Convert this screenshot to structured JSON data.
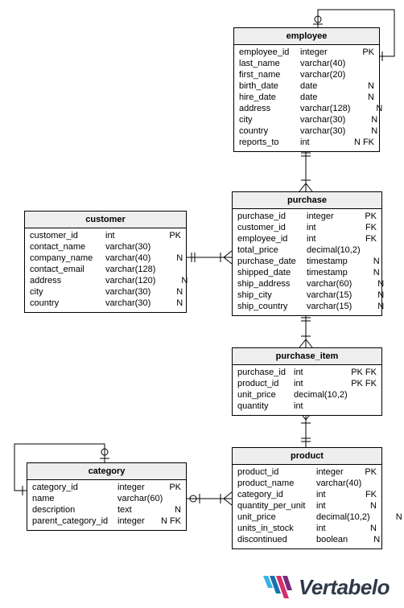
{
  "chart_data": {
    "type": "table",
    "description": "Entity-Relationship diagram",
    "entities": [
      {
        "name": "employee",
        "columns": [
          {
            "name": "employee_id",
            "type": "integer",
            "flag": "PK"
          },
          {
            "name": "last_name",
            "type": "varchar(40)",
            "flag": ""
          },
          {
            "name": "first_name",
            "type": "varchar(20)",
            "flag": ""
          },
          {
            "name": "birth_date",
            "type": "date",
            "flag": "N"
          },
          {
            "name": "hire_date",
            "type": "date",
            "flag": "N"
          },
          {
            "name": "address",
            "type": "varchar(128)",
            "flag": "N"
          },
          {
            "name": "city",
            "type": "varchar(30)",
            "flag": "N"
          },
          {
            "name": "country",
            "type": "varchar(30)",
            "flag": "N"
          },
          {
            "name": "reports_to",
            "type": "int",
            "flag": "N FK"
          }
        ]
      },
      {
        "name": "purchase",
        "columns": [
          {
            "name": "purchase_id",
            "type": "integer",
            "flag": "PK"
          },
          {
            "name": "customer_id",
            "type": "int",
            "flag": "FK"
          },
          {
            "name": "employee_id",
            "type": "int",
            "flag": "FK"
          },
          {
            "name": "total_price",
            "type": "decimal(10,2)",
            "flag": ""
          },
          {
            "name": "purchase_date",
            "type": "timestamp",
            "flag": "N"
          },
          {
            "name": "shipped_date",
            "type": "timestamp",
            "flag": "N"
          },
          {
            "name": "ship_address",
            "type": "varchar(60)",
            "flag": "N"
          },
          {
            "name": "ship_city",
            "type": "varchar(15)",
            "flag": "N"
          },
          {
            "name": "ship_country",
            "type": "varchar(15)",
            "flag": "N"
          }
        ]
      },
      {
        "name": "customer",
        "columns": [
          {
            "name": "customer_id",
            "type": "int",
            "flag": "PK"
          },
          {
            "name": "contact_name",
            "type": "varchar(30)",
            "flag": ""
          },
          {
            "name": "company_name",
            "type": "varchar(40)",
            "flag": "N"
          },
          {
            "name": "contact_email",
            "type": "varchar(128)",
            "flag": ""
          },
          {
            "name": "address",
            "type": "varchar(120)",
            "flag": "N"
          },
          {
            "name": "city",
            "type": "varchar(30)",
            "flag": "N"
          },
          {
            "name": "country",
            "type": "varchar(30)",
            "flag": "N"
          }
        ]
      },
      {
        "name": "purchase_item",
        "columns": [
          {
            "name": "purchase_id",
            "type": "int",
            "flag": "PK FK"
          },
          {
            "name": "product_id",
            "type": "int",
            "flag": "PK FK"
          },
          {
            "name": "unit_price",
            "type": "decimal(10,2)",
            "flag": ""
          },
          {
            "name": "quantity",
            "type": "int",
            "flag": ""
          }
        ]
      },
      {
        "name": "product",
        "columns": [
          {
            "name": "product_id",
            "type": "integer",
            "flag": "PK"
          },
          {
            "name": "product_name",
            "type": "varchar(40)",
            "flag": ""
          },
          {
            "name": "category_id",
            "type": "int",
            "flag": "FK"
          },
          {
            "name": "quantity_per_unit",
            "type": "int",
            "flag": "N"
          },
          {
            "name": "unit_price",
            "type": "decimal(10,2)",
            "flag": "N"
          },
          {
            "name": "units_in_stock",
            "type": "int",
            "flag": "N"
          },
          {
            "name": "discontinued",
            "type": "boolean",
            "flag": "N"
          }
        ]
      },
      {
        "name": "category",
        "columns": [
          {
            "name": "category_id",
            "type": "integer",
            "flag": "PK"
          },
          {
            "name": "name",
            "type": "varchar(60)",
            "flag": ""
          },
          {
            "name": "description",
            "type": "text",
            "flag": "N"
          },
          {
            "name": "parent_category_id",
            "type": "integer",
            "flag": "N FK"
          }
        ]
      }
    ],
    "relationships": [
      {
        "from": "employee.reports_to",
        "to": "employee.employee_id",
        "type": "self, zero-or-one to many"
      },
      {
        "from": "purchase.employee_id",
        "to": "employee.employee_id",
        "type": "one to many"
      },
      {
        "from": "purchase.customer_id",
        "to": "customer.customer_id",
        "type": "one to many"
      },
      {
        "from": "purchase_item.purchase_id",
        "to": "purchase.purchase_id",
        "type": "one to many"
      },
      {
        "from": "purchase_item.product_id",
        "to": "product.product_id",
        "type": "one to many"
      },
      {
        "from": "product.category_id",
        "to": "category.category_id",
        "type": "zero-or-one to many"
      },
      {
        "from": "category.parent_category_id",
        "to": "category.category_id",
        "type": "self, zero-or-one to many"
      }
    ]
  },
  "logo_text": "Vertabelo"
}
